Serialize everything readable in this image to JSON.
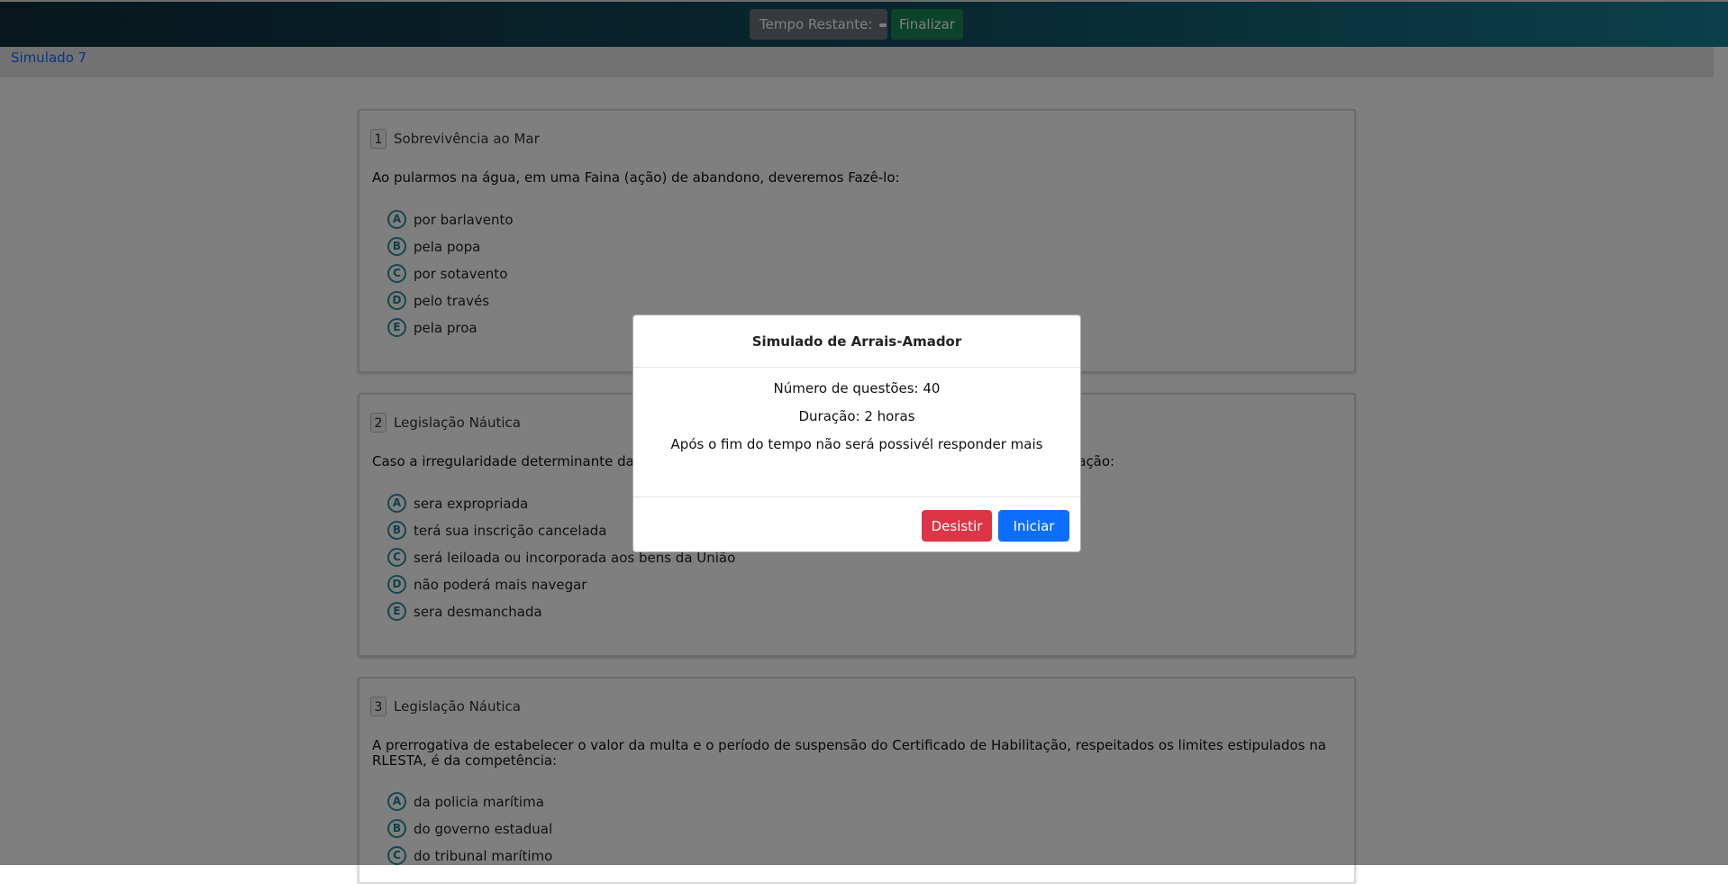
{
  "header": {
    "timer_label": "Tempo Restante:",
    "finish_label": "Finalizar"
  },
  "breadcrumb": {
    "current": "Simulado 7"
  },
  "questions": [
    {
      "number": "1",
      "category": "Sobrevivência ao Mar",
      "text": "Ao pularmos na água, em uma Faina (ação) de abandono, deveremos Fazê-lo:",
      "options": [
        {
          "letter": "A",
          "text": "por barlavento"
        },
        {
          "letter": "B",
          "text": "pela popa"
        },
        {
          "letter": "C",
          "text": "por sotavento"
        },
        {
          "letter": "D",
          "text": "pelo través"
        },
        {
          "letter": "E",
          "text": "pela proa"
        }
      ]
    },
    {
      "number": "2",
      "category": "Legislação Náutica",
      "text_left": "Caso a irregularidade determinante da a",
      "text_right": "cação:",
      "options": [
        {
          "letter": "A",
          "text": "sera expropriada"
        },
        {
          "letter": "B",
          "text": "terá sua inscrição cancelada"
        },
        {
          "letter": "C",
          "text": "será leiloada ou incorporada aos bens da União"
        },
        {
          "letter": "D",
          "text": "não poderá mais navegar"
        },
        {
          "letter": "E",
          "text": "sera desmanchada"
        }
      ]
    },
    {
      "number": "3",
      "category": "Legislação Náutica",
      "text": "A prerrogativa de estabelecer o valor da multa e o período de suspensão do Certificado de Habilitação, respeitados os limites estipulados na RLESTA, é da competência:",
      "options": [
        {
          "letter": "A",
          "text": "da policia marítima"
        },
        {
          "letter": "B",
          "text": "do governo estadual"
        },
        {
          "letter": "C",
          "text": "do tribunal marítimo"
        }
      ]
    }
  ],
  "modal": {
    "title": "Simulado de Arrais-Amador",
    "line1": "Número de questões: 40",
    "line2": "Duração: 2 horas",
    "line3": "Após o fim do tempo não será possivél responder mais",
    "quit_label": "Desistir",
    "start_label": "Iniciar"
  }
}
